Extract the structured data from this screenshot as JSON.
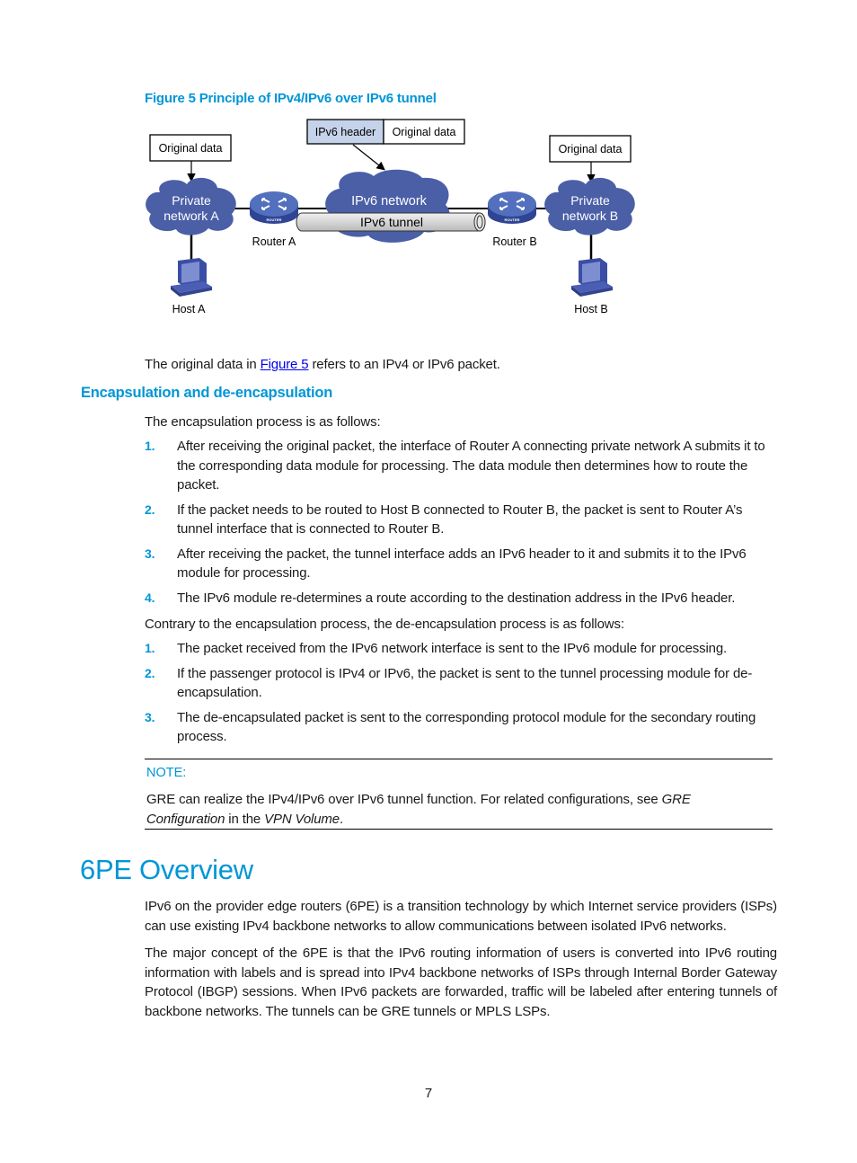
{
  "figure": {
    "caption": "Figure 5 Principle of IPv4/IPv6 over IPv6 tunnel",
    "labels": {
      "original_data_left": "Original data",
      "original_data_right": "Original data",
      "packet_header": "IPv6 header",
      "packet_data": "Original data",
      "private_network_a_line1": "Private",
      "private_network_a_line2": "network A",
      "private_network_b_line1": "Private",
      "private_network_b_line2": "network B",
      "ipv6_network": "IPv6 network",
      "ipv6_tunnel": "IPv6 tunnel",
      "router_a": "Router A",
      "router_b": "Router B",
      "router_badge": "ROUTER",
      "host_a": "Host A",
      "host_b": "Host B"
    },
    "colors": {
      "cloud": "#4a5fa6",
      "router": "#4a64b0",
      "host": "#3b4ea5",
      "header_fill": "#c5d3ea",
      "tunnel_fill": "#d8d8d8"
    },
    "icons": [
      "cloud-icon",
      "router-icon",
      "host-computer-icon",
      "tunnel-pipe-icon"
    ]
  },
  "intro": {
    "before_link": "The original data in ",
    "link": "Figure 5",
    "after_link": " refers to an IPv4 or IPv6 packet."
  },
  "section": {
    "heading": "Encapsulation and de-encapsulation",
    "encap_intro": "The encapsulation process is as follows:",
    "encap_steps": [
      {
        "num": "1.",
        "text": "After receiving the original packet, the interface of Router A connecting private network A submits it to the corresponding data module for processing. The data module then determines how to route the packet."
      },
      {
        "num": "2.",
        "text": "If the packet needs to be routed to Host B connected to Router B, the packet is sent to Router A’s tunnel interface that is connected to Router B."
      },
      {
        "num": "3.",
        "text": "After receiving the packet, the tunnel interface adds an IPv6 header to it and submits it to the IPv6 module for processing."
      },
      {
        "num": "4.",
        "text": "The IPv6 module re-determines a route according to the destination address in the IPv6 header."
      }
    ],
    "decap_intro": "Contrary to the encapsulation process, the de-encapsulation process is as follows:",
    "decap_steps": [
      {
        "num": "1.",
        "text": "The packet received from the IPv6 network interface is sent to the IPv6 module for processing."
      },
      {
        "num": "2.",
        "text": "If the passenger protocol is IPv4 or IPv6, the packet is sent to the tunnel processing module for de-encapsulation."
      },
      {
        "num": "3.",
        "text": "The de-encapsulated packet is sent to the corresponding protocol module for the secondary routing process."
      }
    ]
  },
  "note": {
    "label": "NOTE:",
    "text_1": "GRE can realize the IPv4/IPv6 over IPv6 tunnel function. For related configurations, see ",
    "italic_1": "GRE Configuration",
    "text_2": " in the ",
    "italic_2": "VPN Volume",
    "text_3": "."
  },
  "overview": {
    "title": "6PE Overview",
    "para_1": "IPv6 on the provider edge routers (6PE) is a transition technology by which Internet service providers (ISPs) can use existing IPv4 backbone networks to allow communications between isolated IPv6 networks.",
    "para_2": "The major concept of the 6PE is that the IPv6 routing information of users is converted into IPv6 routing information with labels and is spread into IPv4 backbone networks of ISPs through Internal Border Gateway Protocol (IBGP) sessions. When IPv6 packets are forwarded, traffic will be labeled after entering tunnels of backbone networks. The tunnels can be GRE tunnels or MPLS LSPs."
  },
  "page_number": "7"
}
